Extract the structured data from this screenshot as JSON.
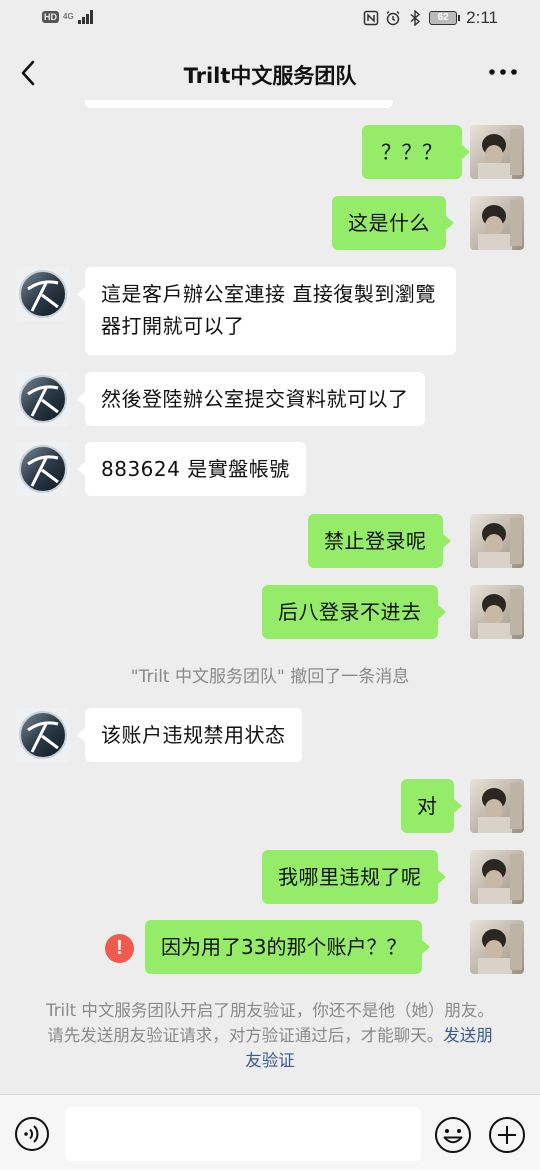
{
  "status_bar": {
    "hd_label": "HD",
    "network_label": "4G",
    "battery_level": "62",
    "time": "2:11",
    "icons": [
      "nfc-icon",
      "alarm-icon",
      "bluetooth-icon"
    ]
  },
  "header": {
    "title": "Trilt中文服务团队",
    "back_icon": "chevron-left-icon",
    "more_icon": "more-dots-icon"
  },
  "messages": [
    {
      "direction": "out",
      "text": "？？？"
    },
    {
      "direction": "out",
      "text": "这是什么"
    },
    {
      "direction": "in",
      "text": "這是客戶辦公室連接 直接復製到瀏覽器打開就可以了"
    },
    {
      "direction": "in",
      "text": "然後登陸辦公室提交資料就可以了"
    },
    {
      "direction": "in",
      "text": "883624 是實盤帳號"
    },
    {
      "direction": "out",
      "text": "禁止登录呢"
    },
    {
      "direction": "out",
      "text": "后八登录不进去"
    },
    {
      "direction": "in",
      "text": "该账户违规禁用状态"
    },
    {
      "direction": "out",
      "text": "对"
    },
    {
      "direction": "out",
      "text": "我哪里违规了呢"
    },
    {
      "direction": "out",
      "text": "因为用了33的那个账户？？",
      "failed": true
    }
  ],
  "system_message": "\"Trilt 中文服务团队\" 撤回了一条消息",
  "failed_mark": "!",
  "friend_notice": {
    "text": "Trilt 中文服务团队开启了朋友验证，你还不是他（她）朋友。请先发送朋友验证请求，对方验证通过后，才能聊天。",
    "link": "发送朋友验证"
  },
  "input_bar": {
    "voice_icon": "voice-icon",
    "emoji_icon": "emoji-icon",
    "plus_icon": "plus-icon",
    "value": ""
  },
  "colors": {
    "background": "#ededed",
    "outgoing_bubble": "#95ec69",
    "incoming_bubble": "#ffffff",
    "error": "#f15a4f",
    "link": "#3a5a8c"
  }
}
